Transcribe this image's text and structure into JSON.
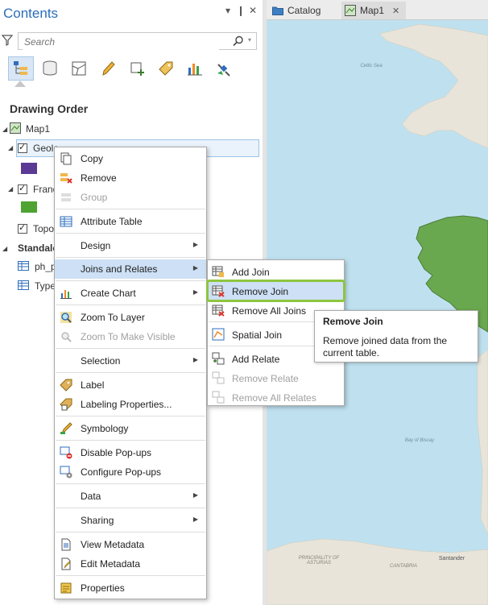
{
  "contents_pane": {
    "title": "Contents",
    "controls": {
      "dropdown": "▾",
      "pin": "❙",
      "close": "✕"
    },
    "search": {
      "placeholder": "Search",
      "value": ""
    },
    "toolbar_icons": [
      "list-by-drawing-order-icon",
      "list-by-source-icon",
      "list-by-selection-icon",
      "list-by-editing-icon",
      "list-by-snapping-icon",
      "list-by-labeling-icon",
      "list-by-charts-icon",
      "list-by-perspective-imagery-icon"
    ],
    "section_title": "Drawing Order",
    "tree": {
      "map": "Map1",
      "layers": [
        {
          "label": "Geolo",
          "color": "#5b3a96",
          "checked": true
        },
        {
          "label": "Franc",
          "color": "#4ea333",
          "checked": true
        },
        {
          "label": "Topo",
          "checked": true
        }
      ],
      "standalone_header": "Standalo",
      "standalone_tables": [
        "ph_p",
        "Type"
      ]
    }
  },
  "tabs": [
    {
      "label": "Catalog",
      "icon": "catalog-icon"
    },
    {
      "label": "Map1",
      "icon": "map-icon",
      "close": "✕"
    }
  ],
  "map": {
    "labels": [
      "Celtic Sea",
      "Bay of Biscay",
      "Santander",
      "PRINCIPALITY OF ASTURIAS",
      "CANTABRIA"
    ],
    "colors": {
      "water": "#bfe1ef",
      "land": "#e8e4da",
      "selected_land": "#6aa84f"
    }
  },
  "context_menu": {
    "items": [
      {
        "label": "Copy",
        "icon": "copy-icon",
        "enabled": true
      },
      {
        "label": "Remove",
        "icon": "remove-icon",
        "enabled": true
      },
      {
        "label": "Group",
        "icon": "group-icon",
        "enabled": false
      },
      {
        "label": "Attribute Table",
        "icon": "attribute-table-icon",
        "enabled": true
      },
      {
        "label": "Design",
        "submenu": true,
        "enabled": true
      },
      {
        "label": "Joins and Relates",
        "submenu": true,
        "enabled": true,
        "active": true
      },
      {
        "label": "Create Chart",
        "icon": "chart-icon",
        "submenu": true,
        "enabled": true
      },
      {
        "label": "Zoom To Layer",
        "icon": "zoom-to-layer-icon",
        "enabled": true
      },
      {
        "label": "Zoom To Make Visible",
        "icon": "zoom-visible-icon",
        "enabled": false
      },
      {
        "label": "Selection",
        "submenu": true,
        "enabled": true
      },
      {
        "label": "Label",
        "icon": "label-icon",
        "enabled": true
      },
      {
        "label": "Labeling Properties...",
        "icon": "labeling-properties-icon",
        "enabled": true
      },
      {
        "label": "Symbology",
        "icon": "symbology-icon",
        "enabled": true
      },
      {
        "label": "Disable Pop-ups",
        "icon": "disable-popups-icon",
        "enabled": true
      },
      {
        "label": "Configure Pop-ups",
        "icon": "configure-popups-icon",
        "enabled": true
      },
      {
        "label": "Data",
        "submenu": true,
        "enabled": true
      },
      {
        "label": "Sharing",
        "submenu": true,
        "enabled": true
      },
      {
        "label": "View Metadata",
        "icon": "view-metadata-icon",
        "enabled": true
      },
      {
        "label": "Edit Metadata",
        "icon": "edit-metadata-icon",
        "enabled": true
      },
      {
        "label": "Properties",
        "icon": "properties-icon",
        "enabled": true
      }
    ]
  },
  "submenu": {
    "items": [
      {
        "label": "Add Join",
        "icon": "add-join-icon",
        "enabled": true
      },
      {
        "label": "Remove Join",
        "icon": "remove-join-icon",
        "enabled": true,
        "highlighted": true
      },
      {
        "label": "Remove All Joins",
        "icon": "remove-all-joins-icon",
        "enabled": true
      },
      {
        "label": "Spatial Join",
        "icon": "spatial-join-icon",
        "enabled": true
      },
      {
        "label": "Add Relate",
        "icon": "add-relate-icon",
        "enabled": true
      },
      {
        "label": "Remove Relate",
        "icon": "remove-relate-icon",
        "enabled": false
      },
      {
        "label": "Remove All Relates",
        "icon": "remove-all-relates-icon",
        "enabled": false
      }
    ]
  },
  "tooltip": {
    "title": "Remove Join",
    "body": "Remove joined data from the current table."
  },
  "accent_color": "#8dc63f"
}
